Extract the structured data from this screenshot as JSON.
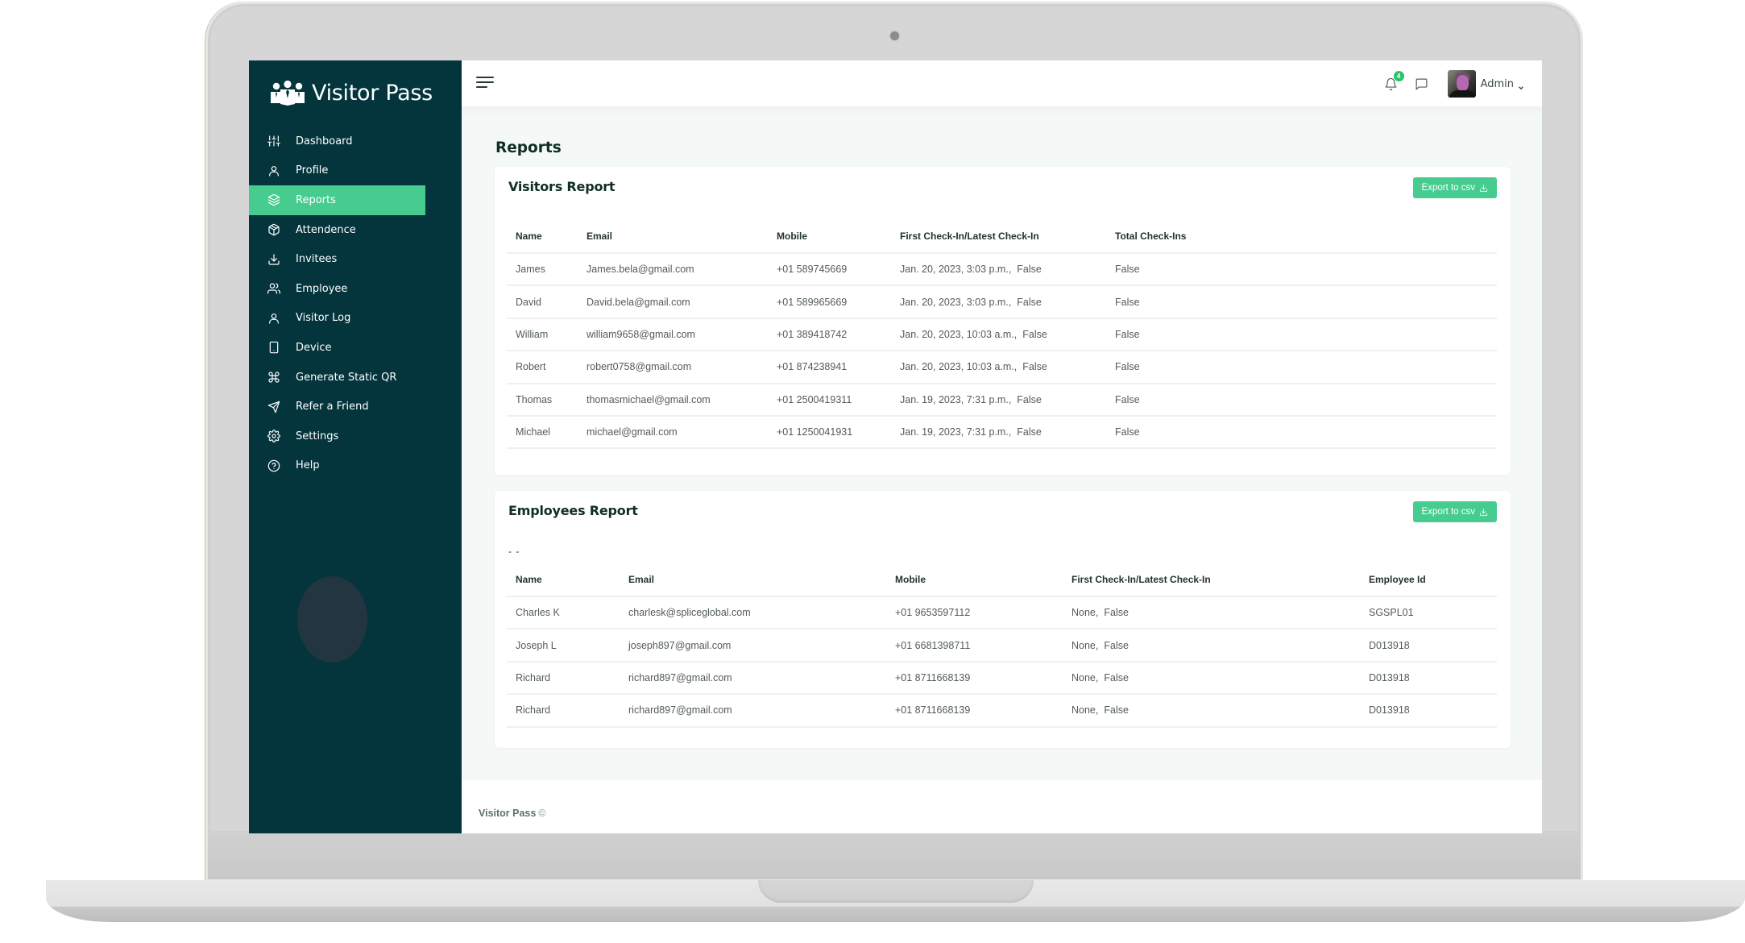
{
  "app": {
    "name": "Visitor Pass",
    "logo_icon": "users-group-icon"
  },
  "sidebar": {
    "items": [
      {
        "label": "Dashboard",
        "icon": "sliders-icon",
        "active": false
      },
      {
        "label": "Profile",
        "icon": "user-icon",
        "active": false
      },
      {
        "label": "Reports",
        "icon": "layers-icon",
        "active": true
      },
      {
        "label": "Attendence",
        "icon": "box-icon",
        "active": false
      },
      {
        "label": "Invitees",
        "icon": "download-icon",
        "active": false
      },
      {
        "label": "Employee",
        "icon": "users-icon",
        "active": false
      },
      {
        "label": "Visitor Log",
        "icon": "user-icon",
        "active": false
      },
      {
        "label": "Device",
        "icon": "tablet-icon",
        "active": false
      },
      {
        "label": "Generate Static QR",
        "icon": "command-icon",
        "active": false
      },
      {
        "label": "Refer a Friend",
        "icon": "send-icon",
        "active": false
      },
      {
        "label": "Settings",
        "icon": "gear-icon",
        "active": false
      },
      {
        "label": "Help",
        "icon": "help-circle-icon",
        "active": false
      }
    ]
  },
  "topbar": {
    "notification_count": "4",
    "user_name": "Admin"
  },
  "colors": {
    "sidebar_bg": "#04353d",
    "accent": "#47cc8f",
    "badge": "#28c56a"
  },
  "page": {
    "title": "Reports"
  },
  "visitors_report": {
    "title": "Visitors Report",
    "export_label": "Export to csv",
    "columns": [
      "Name",
      "Email",
      "Mobile",
      "First Check-In/Latest Check-In",
      "Total Check-Ins"
    ],
    "rows": [
      {
        "name": "James",
        "email": "James.bela@gmail.com",
        "mobile": "+01 589745669",
        "first_checkin": "Jan. 20, 2023, 3:03 p.m.,",
        "latest_checkin": "False",
        "total": "False"
      },
      {
        "name": "David",
        "email": "David.bela@gmail.com",
        "mobile": "+01 589965669",
        "first_checkin": "Jan. 20, 2023, 3:03 p.m.,",
        "latest_checkin": "False",
        "total": "False"
      },
      {
        "name": "William",
        "email": "william9658@gmail.com",
        "mobile": "+01 389418742",
        "first_checkin": "Jan. 20, 2023, 10:03 a.m.,",
        "latest_checkin": "False",
        "total": "False"
      },
      {
        "name": "Robert",
        "email": "robert0758@gmail.com",
        "mobile": "+01 874238941",
        "first_checkin": "Jan. 20, 2023, 10:03 a.m.,",
        "latest_checkin": "False",
        "total": "False"
      },
      {
        "name": "Thomas",
        "email": "thomasmichael@gmail.com",
        "mobile": "+01 2500419311",
        "first_checkin": "Jan. 19, 2023, 7:31 p.m.,",
        "latest_checkin": "False",
        "total": "False"
      },
      {
        "name": "Michael",
        "email": "michael@gmail.com",
        "mobile": "+01 1250041931",
        "first_checkin": "Jan. 19, 2023, 7:31 p.m.,",
        "latest_checkin": "False",
        "total": "False"
      }
    ]
  },
  "employees_report": {
    "title": "Employees Report",
    "export_label": "Export to csv",
    "placeholder_text": "- -",
    "columns": [
      "Name",
      "Email",
      "Mobile",
      "First Check-In/Latest Check-In",
      "Employee Id"
    ],
    "rows": [
      {
        "name": "Charles K",
        "email": "charlesk@spliceglobal.com",
        "mobile": "+01 9653597112",
        "first_checkin": "None,",
        "latest_checkin": "False",
        "employee_id": "SGSPL01"
      },
      {
        "name": "Joseph L",
        "email": "joseph897@gmail.com",
        "mobile": "+01 6681398711",
        "first_checkin": "None,",
        "latest_checkin": "False",
        "employee_id": "D013918"
      },
      {
        "name": "Richard",
        "email": "richard897@gmail.com",
        "mobile": "+01 8711668139",
        "first_checkin": "None,",
        "latest_checkin": "False",
        "employee_id": "D013918"
      },
      {
        "name": "Richard",
        "email": "richard897@gmail.com",
        "mobile": "+01 8711668139",
        "first_checkin": "None,",
        "latest_checkin": "False",
        "employee_id": "D013918"
      }
    ]
  },
  "footer": {
    "brand": "Visitor Pass",
    "copyright_symbol": "©"
  }
}
